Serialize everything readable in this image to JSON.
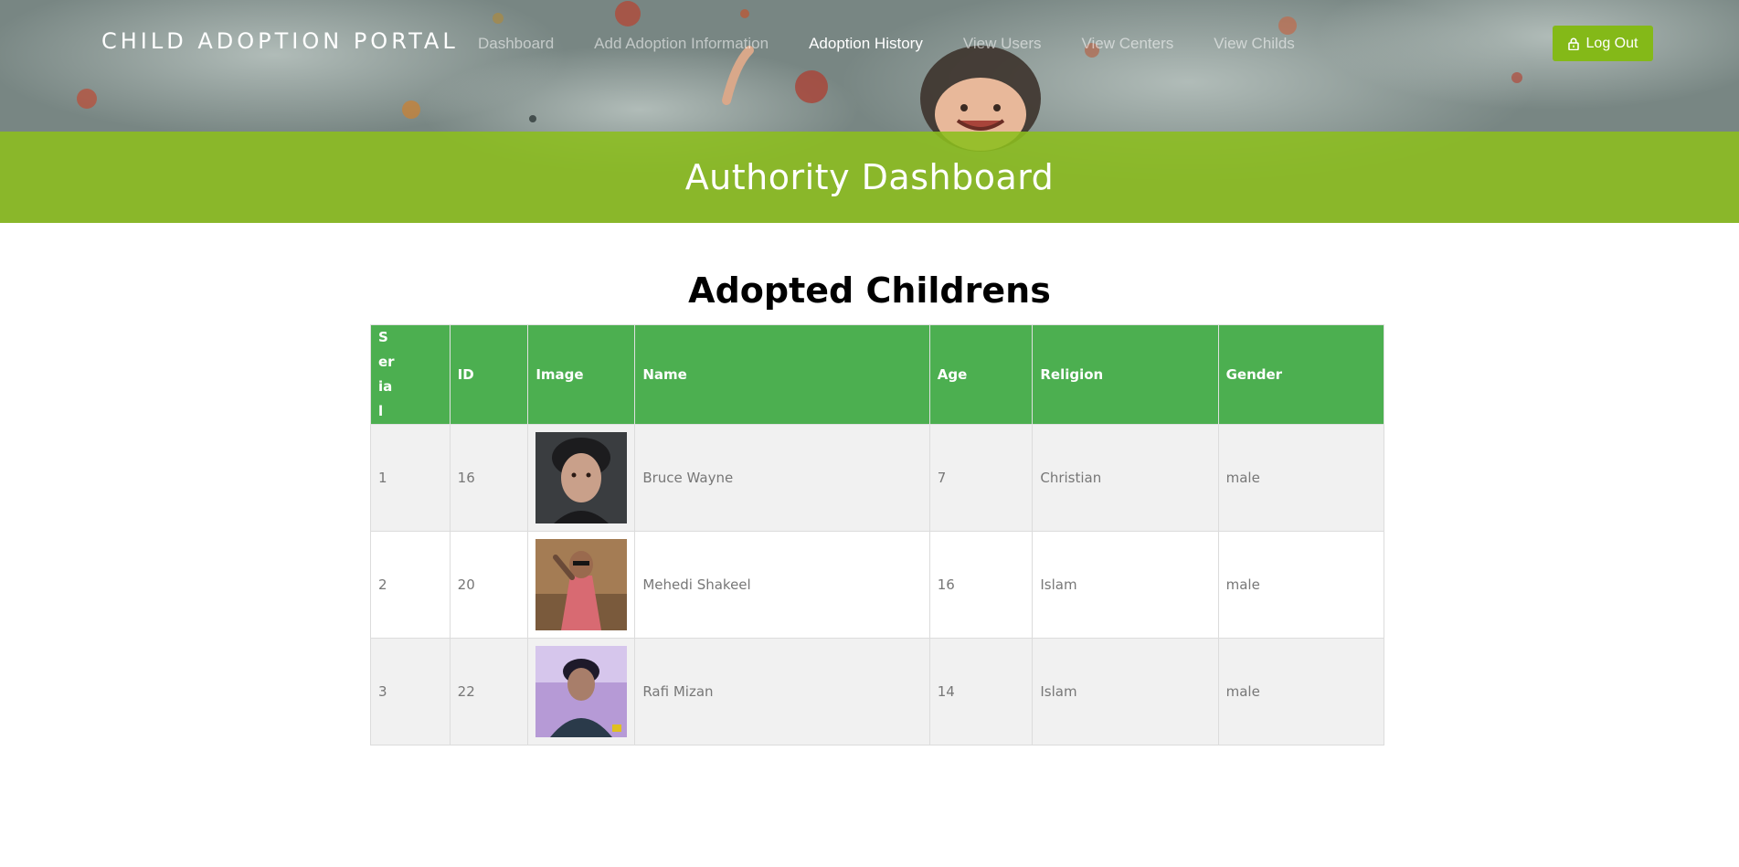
{
  "navbar": {
    "brand": "CHILD ADOPTION PORTAL",
    "links": [
      "Dashboard",
      "Add Adoption Information",
      "Adoption History",
      "View Users",
      "View Centers",
      "View Childs"
    ],
    "active_link": "Adoption History",
    "logout_label": "Log Out",
    "logout_icon": "lock-icon"
  },
  "banner": {
    "title": "Authority Dashboard"
  },
  "main": {
    "section_title": "Adopted Childrens",
    "table": {
      "headers": [
        "Serial",
        "ID",
        "Image",
        "Name",
        "Age",
        "Religion",
        "Gender"
      ],
      "rows": [
        {
          "serial": "1",
          "id": "16",
          "image": "portrait-photo",
          "name": "Bruce Wayne",
          "age": "7",
          "religion": "Christian",
          "gender": "male"
        },
        {
          "serial": "2",
          "id": "20",
          "image": "portrait-photo",
          "name": "Mehedi Shakeel",
          "age": "16",
          "religion": "Islam",
          "gender": "male"
        },
        {
          "serial": "3",
          "id": "22",
          "image": "portrait-photo",
          "name": "Rafi Mizan",
          "age": "14",
          "religion": "Islam",
          "gender": "male"
        }
      ]
    }
  },
  "colors": {
    "accent": "#84b918",
    "banner": "#8cbe1e",
    "table_header": "#4caf50",
    "row_alt": "#f1f1f1"
  }
}
